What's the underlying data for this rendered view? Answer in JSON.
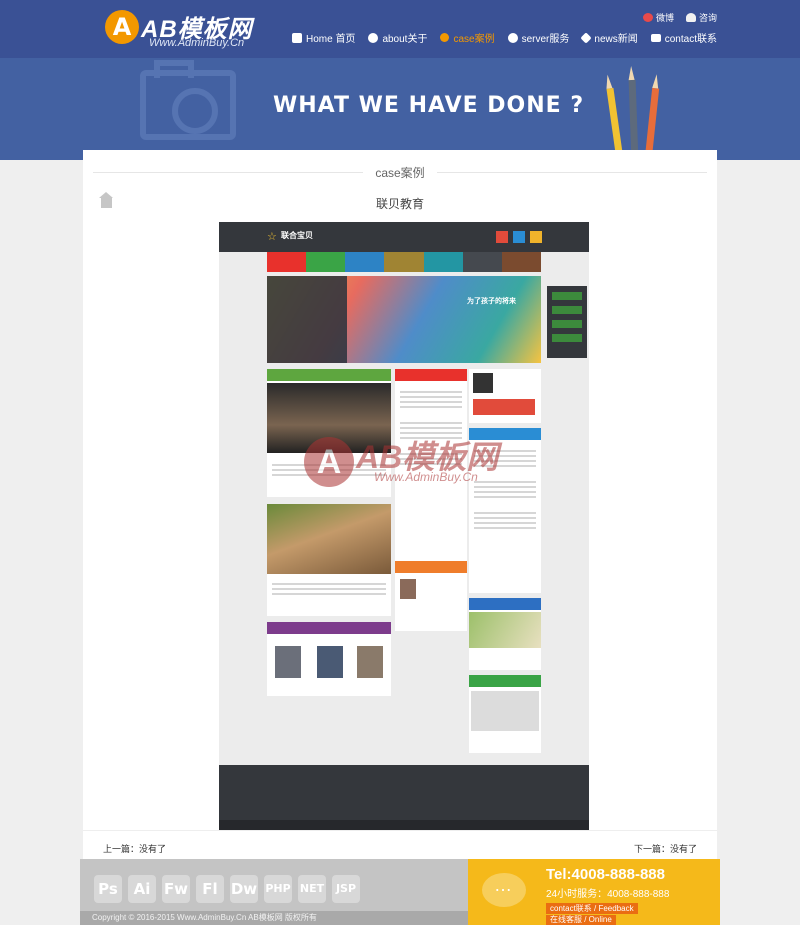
{
  "header": {
    "logo_mark": "A",
    "logo_text": "AB模板网",
    "logo_url": "Www.AdminBuy.Cn",
    "top_links": [
      {
        "label": "微博",
        "icon": "weibo-icon"
      },
      {
        "label": "咨询",
        "icon": "person-icon"
      }
    ],
    "nav": [
      {
        "label": "Home 首页",
        "icon": "home-icon",
        "active": false
      },
      {
        "label": "about关于",
        "icon": "info-icon",
        "active": false
      },
      {
        "label": "case案例",
        "icon": "link-icon",
        "active": true
      },
      {
        "label": "server服务",
        "icon": "gear-icon",
        "active": false
      },
      {
        "label": "news新闻",
        "icon": "wrench-icon",
        "active": false
      },
      {
        "label": "contact联系",
        "icon": "mail-icon",
        "active": false
      }
    ]
  },
  "banner": {
    "title": "WHAT WE HAVE DONE ?"
  },
  "main": {
    "section_title": "case案例",
    "article_title": "联贝教育",
    "prev_link": "上一篇：没有了",
    "next_link": "下一篇：没有了"
  },
  "screenshot": {
    "site_name": "联合宝贝",
    "hero_text": "为了孩子的将来",
    "watermark_text": "AB模板网",
    "watermark_url": "Www.AdminBuy.Cn"
  },
  "footer": {
    "tools": [
      "Ps",
      "Ai",
      "Fw",
      "Fl",
      "Dw",
      "PHP",
      "NET",
      "JSP"
    ],
    "copyright": "Copyright © 2016-2015 Www.AdminBuy.Cn AB模板网 版权所有",
    "tel": "Tel:4008-888-888",
    "hotline": "24小时服务：4008-888-888",
    "feedback_label": "contact联系 / Feedback",
    "online_label": "在线客服 / Online"
  },
  "colors": {
    "header_bg": "#3a5195",
    "banner_bg": "#4361a2",
    "accent": "#f39800",
    "footer_right_bg": "#f5b91a"
  }
}
